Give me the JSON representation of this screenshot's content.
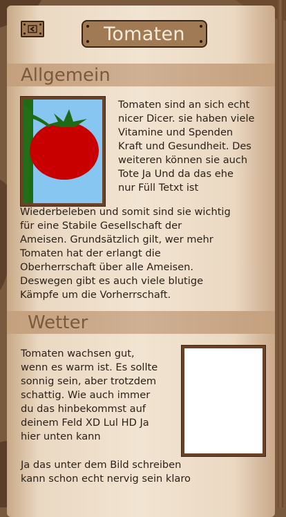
{
  "header": {
    "title": "Tomaten",
    "back_icon": "chevron-left-icon"
  },
  "sections": {
    "general": {
      "title": "Allgemein",
      "image_icon": "tomato-illustration",
      "text_beside_image": [
        "Tomaten sind an sich echt",
        "nicer Dicer. sie haben viele",
        "Vitamine und Spenden",
        "Kraft und Gesundheit. Des",
        "weiteren können sie auch",
        "Tote Ja Und da das ehe",
        "nur Füll Tetxt ist"
      ],
      "text_below_image": [
        "Wiederbeleben und somit sind sie wichtig",
        "für eine Stabile Gesellschaft der",
        "Ameisen. Grundsätzlich gilt, wer mehr",
        "Tomaten hat der erlangt die",
        "Oberherrschaft über alle Ameisen.",
        "Deswegen gibt es auch viele blutige",
        "Kämpfe um die Vorherrschaft."
      ]
    },
    "weather": {
      "title": "Wetter",
      "text_main": [
        "Tomaten wachsen gut,",
        "wenn es warm ist. Es sollte",
        "sonnig sein, aber trotzdem",
        "schattig. Wie auch immer",
        "du das hinbekommst auf",
        "deinem Feld XD Lul HD Ja",
        "hier unten kann"
      ],
      "text_footer": [
        "Ja das unter dem Bild schreiben",
        "kann schon echt nervig sein klaro"
      ]
    }
  },
  "colors": {
    "wood_dark": "#3b2414",
    "wood": "#6b4226",
    "plate": "#a07a55",
    "parchment": "#f2e4d2",
    "section_bar": "#c9a98a",
    "section_title": "#7b5a3c",
    "tomato_red": "#c80000",
    "sky": "#87c6f0",
    "leaf_green": "#1f6a14"
  }
}
